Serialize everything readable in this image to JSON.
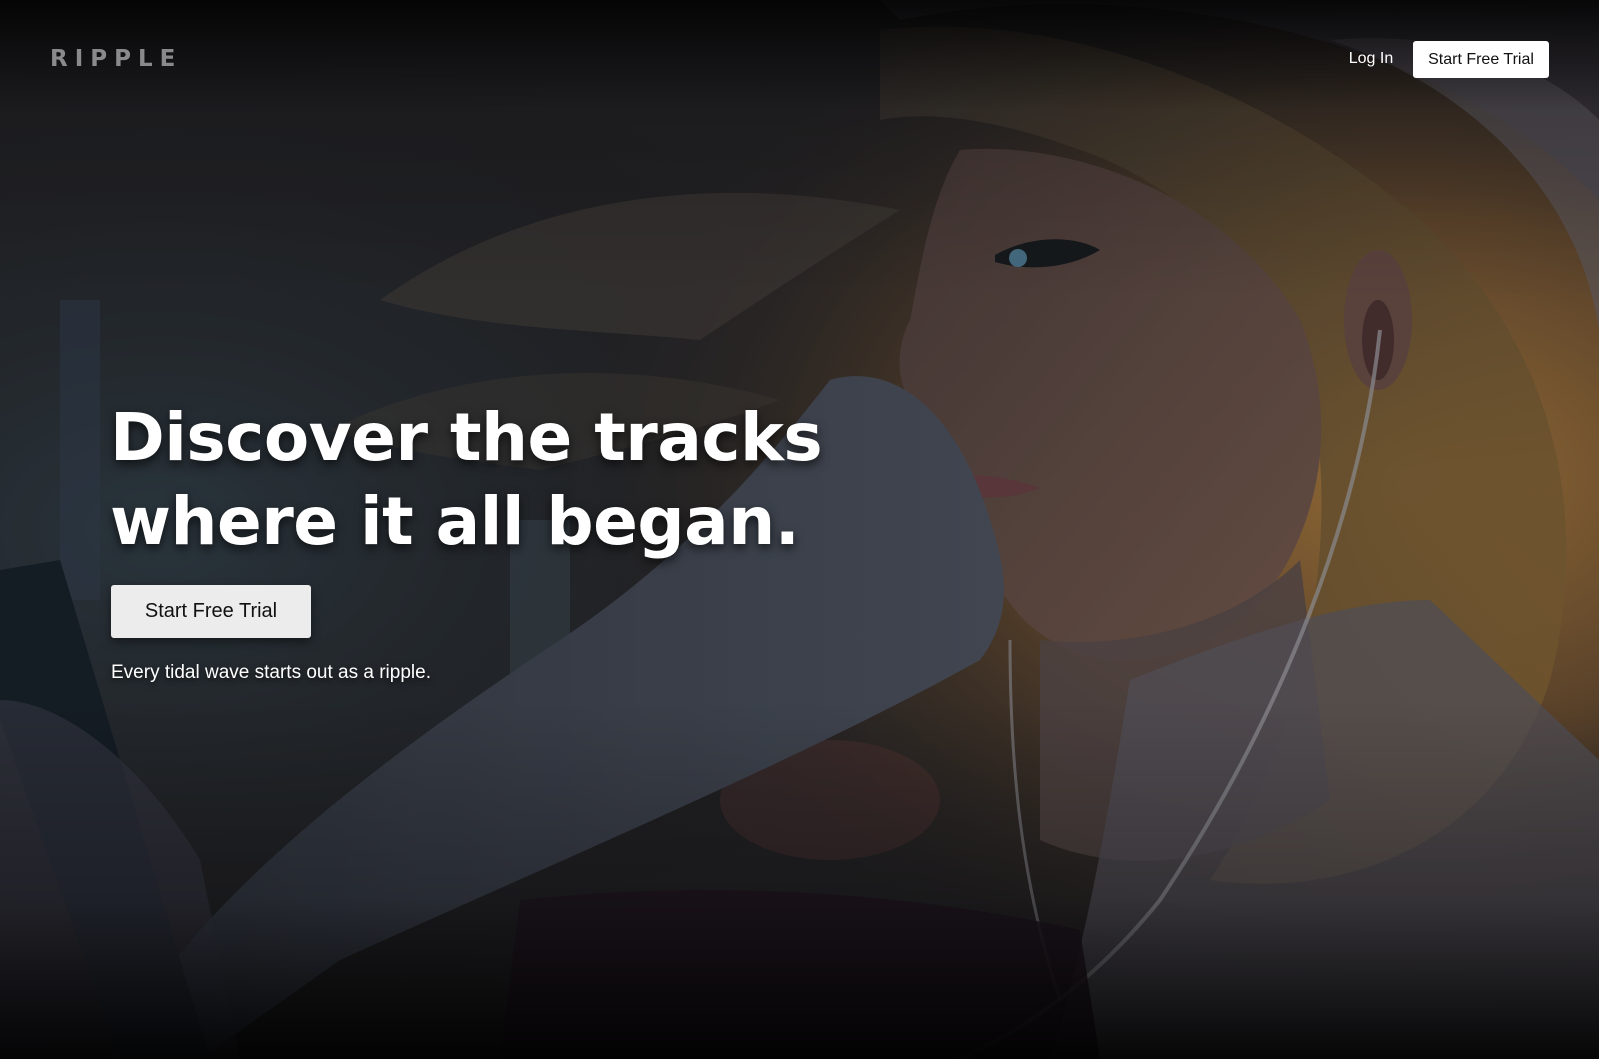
{
  "brand": {
    "name": "RIPPLE"
  },
  "nav": {
    "login_label": "Log In",
    "trial_label": "Start Free Trial"
  },
  "hero": {
    "headline_line1": "Discover the tracks",
    "headline_line2": "where it all began.",
    "cta_label": "Start Free Trial",
    "tagline": "Every tidal wave starts out as a ripple.",
    "background_image": "illustration-girl-with-earphones"
  },
  "colors": {
    "page_background": "#1a1a1c",
    "brand_text": "#8a8a8c",
    "headline_text": "#ffffff",
    "nav_button_background": "#ffffff",
    "cta_button_background": "#ececec",
    "button_text": "#111111"
  }
}
